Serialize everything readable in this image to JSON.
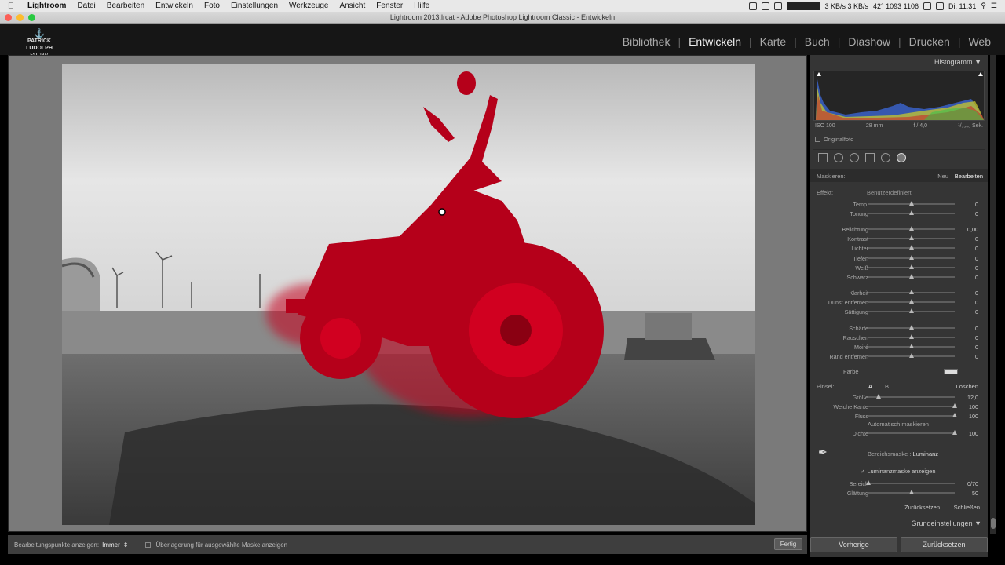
{
  "menubar": {
    "app": "Lightroom",
    "items": [
      "Datei",
      "Bearbeiten",
      "Entwickeln",
      "Foto",
      "Einstellungen",
      "Werkzeuge",
      "Ansicht",
      "Fenster",
      "Hilfe"
    ],
    "net": "3 KB/s 3 KB/s",
    "temp": "42° 1093 1106",
    "clock": "Di. 11:31"
  },
  "window": {
    "title": "Lightroom 2013.lrcat - Adobe Photoshop Lightroom Classic - Entwickeln"
  },
  "brand": {
    "line1": "PATRICK LUDOLPH",
    "line2": "EST. 1977"
  },
  "modules": [
    "Bibliothek",
    "Entwickeln",
    "Karte",
    "Buch",
    "Diashow",
    "Drucken",
    "Web"
  ],
  "active_module": "Entwickeln",
  "panel": {
    "histogram_title": "Histogramm",
    "exif": {
      "iso": "ISO 100",
      "focal": "28 mm",
      "aperture": "f / 4,0",
      "shutter": "¹/₃₅₀₀ Sek."
    },
    "original": "Originalfoto",
    "mask_label": "Maskieren:",
    "mask_new": "Neu",
    "mask_edit": "Bearbeiten",
    "effect_label": "Effekt:",
    "effect_value": "Benutzerdefiniert",
    "sliders": [
      {
        "label": "Temp.",
        "value": "0",
        "pos": 0.5
      },
      {
        "label": "Tonung",
        "value": "0",
        "pos": 0.5
      },
      {
        "label": "Belichtung",
        "value": "0,00",
        "pos": 0.5
      },
      {
        "label": "Kontrast",
        "value": "0",
        "pos": 0.5
      },
      {
        "label": "Lichter",
        "value": "0",
        "pos": 0.5
      },
      {
        "label": "Tiefen",
        "value": "0",
        "pos": 0.5
      },
      {
        "label": "Weiß",
        "value": "0",
        "pos": 0.5
      },
      {
        "label": "Schwarz",
        "value": "0",
        "pos": 0.5
      },
      {
        "label": "Klarheit",
        "value": "0",
        "pos": 0.5
      },
      {
        "label": "Dunst entfernen",
        "value": "0",
        "pos": 0.5
      },
      {
        "label": "Sättigung",
        "value": "0",
        "pos": 0.5
      },
      {
        "label": "Schärfe",
        "value": "0",
        "pos": 0.5
      },
      {
        "label": "Rauschen",
        "value": "0",
        "pos": 0.5
      },
      {
        "label": "Moiré",
        "value": "0",
        "pos": 0.5
      },
      {
        "label": "Rand entfernen",
        "value": "0",
        "pos": 0.5
      }
    ],
    "farbe": "Farbe",
    "brush_label": "Pinsel:",
    "brush_a": "A",
    "brush_b": "B",
    "brush_delete": "Löschen",
    "brush_sliders": [
      {
        "label": "Größe",
        "value": "12,0",
        "pos": 0.12
      },
      {
        "label": "Weiche Kante",
        "value": "100",
        "pos": 1.0
      },
      {
        "label": "Fluss",
        "value": "100",
        "pos": 1.0
      }
    ],
    "automask": "Automatisch maskieren",
    "density": {
      "label": "Dichte",
      "value": "100",
      "pos": 1.0
    },
    "range_label": "Bereichsmaske :",
    "range_value": "Luminanz",
    "lum_overlay": "Luminanzmaske anzeigen",
    "range_sliders": [
      {
        "label": "Bereich",
        "value": "0/70",
        "pos": 0.0
      },
      {
        "label": "Glättung",
        "value": "50",
        "pos": 0.5
      }
    ],
    "reset": "Zurücksetzen",
    "close": "Schließen",
    "basic": "Grundeinstellungen"
  },
  "toolbar": {
    "edit_points_label": "Bearbeitungspunkte anzeigen:",
    "edit_points_value": "Immer",
    "overlay_label": "Überlagerung für ausgewählte Maske anzeigen",
    "done": "Fertig"
  },
  "buttons": {
    "previous": "Vorherige",
    "reset": "Zurücksetzen"
  }
}
